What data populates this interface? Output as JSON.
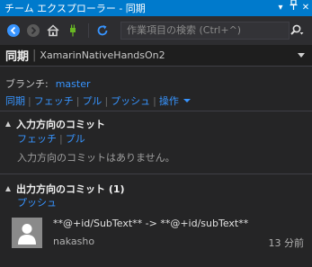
{
  "window": {
    "title": "チーム エクスプローラー - 同期",
    "dropdown_icon": "▾",
    "pin_icon": "📌",
    "close_icon": "✕"
  },
  "toolbar": {
    "back_icon": "arrow-left-circle",
    "forward_icon": "arrow-right-circle",
    "home_icon": "home",
    "connect_icon": "plug",
    "refresh_icon": "refresh",
    "search_placeholder": "作業項目の検索 (Ctrl+^)",
    "search_icon": "search"
  },
  "header": {
    "page_title": "同期",
    "divider": "|",
    "repo_name": "XamarinNativeHandsOn2"
  },
  "branch": {
    "label": "ブランチ:",
    "name": "master"
  },
  "actions": {
    "sync": "同期",
    "fetch": "フェッチ",
    "pull": "プル",
    "push": "プッシュ",
    "more": "操作"
  },
  "incoming": {
    "title": "入力方向のコミット",
    "fetch": "フェッチ",
    "pull": "プル",
    "empty": "入力方向のコミットはありません。"
  },
  "outgoing": {
    "title": "出力方向のコミット (1)",
    "push": "プッシュ",
    "commits": [
      {
        "message": "**@+id/SubText** -> **@+id/subText**",
        "author": "nakasho",
        "time": "13 分前"
      }
    ]
  },
  "colors": {
    "accent": "#007acc",
    "link": "#3794ff",
    "background": "#252526"
  }
}
